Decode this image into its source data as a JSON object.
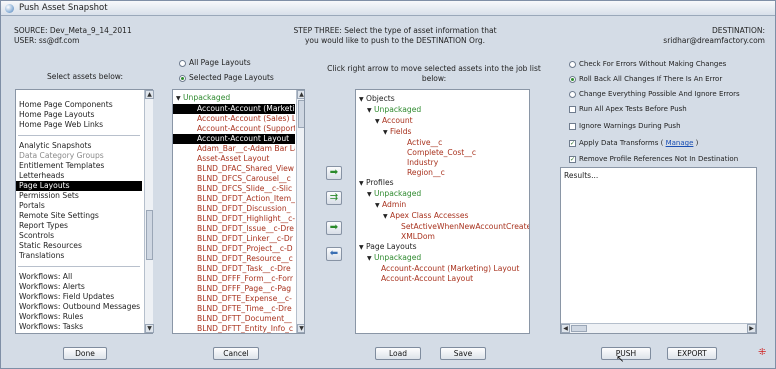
{
  "window": {
    "title": "Push Asset Snapshot"
  },
  "header": {
    "source": "SOURCE: Dev_Meta_9_14_2011",
    "user": "USER: ss@df.com",
    "step_line1": "STEP THREE: Select the type of asset information that",
    "step_line2": "you would like to push to the DESTINATION Org.",
    "dest_label": "DESTINATION:",
    "dest_user": "sridhar@dreamfactory.com"
  },
  "left": {
    "prompt": "Select assets below:",
    "groups": [
      [
        "Home Page Components",
        "Home Page Layouts",
        "Home Page Web Links"
      ],
      [
        "Analytic Snapshots",
        "Data Category Groups",
        "Entitlement Templates",
        "Letterheads",
        "Page Layouts",
        "Permission Sets",
        "Portals",
        "Remote Site Settings",
        "Report Types",
        "Scontrols",
        "Static Resources",
        "Translations"
      ],
      [
        "Workflows: All",
        "Workflows: Alerts",
        "Workflows: Field Updates",
        "Workflows: Outbound Messages",
        "Workflows: Rules",
        "Workflows: Tasks"
      ]
    ],
    "done": "Done"
  },
  "middle": {
    "radio_all": "All Page Layouts",
    "radio_selected": "Selected Page Layouts",
    "root": "Unpackaged",
    "items": [
      "Account-Account (Marketing",
      "Account-Account (Sales) La",
      "Account-Account (Support) L",
      "Account-Account Layout",
      "Adam_Bar__c-Adam Bar La",
      "Asset-Asset Layout",
      "BLND_DFAC_Shared_View",
      "BLND_DFCS_Carousel__c",
      "BLND_DFCS_Slide__c-Slic",
      "BLND_DFDT_Action_Item_",
      "BLND_DFDT_Discussion_",
      "BLND_DFDT_Highlight__c-",
      "BLND_DFDT_Issue__c-Dre",
      "BLND_DFDT_Linker__c-Dr",
      "BLND_DFDT_Project__c-D",
      "BLND_DFDT_Resource__c",
      "BLND_DFDT_Task__c-Dre",
      "BLND_DFFF_Form__c-Forr",
      "BLND_DFFF_Page__c-Pag",
      "BLND_DFTE_Expense__c-",
      "BLND_DFTE_Time__c-Dre",
      "BLND_DFTT_Document__",
      "BLND_DFTT_Entity_Info_c"
    ],
    "cancel": "Cancel"
  },
  "job": {
    "instruction_line1": "Click right arrow to move selected assets into the job list",
    "instruction_line2": "below:",
    "tree": {
      "objects": "Objects",
      "unpackaged": "Unpackaged",
      "account": "Account",
      "fields": "Fields",
      "field_items": [
        "Active__c",
        "Complete_Cost__c",
        "Industry",
        "Region__c"
      ],
      "profiles": "Profiles",
      "admin": "Admin",
      "apex": "Apex Class Accesses",
      "apex_items": [
        "SetActiveWhenNewAccountCreate",
        "XMLDom"
      ],
      "page_layouts": "Page Layouts",
      "layout_items": [
        "Account-Account (Marketing) Layout",
        "Account-Account Layout"
      ]
    },
    "load": "Load",
    "save": "Save"
  },
  "options": {
    "check_errors": "Check For Errors Without Making Changes",
    "rollback": "Roll Back All Changes If There Is An Error",
    "change_everything": "Change Everything Possible And Ignore Errors",
    "run_apex": "Run All Apex Tests Before Push",
    "ignore_warnings": "Ignore Warnings During Push",
    "apply_transforms": "Apply Data Transforms (",
    "manage": "Manage",
    "apply_transforms_end": ")",
    "remove_profile": "Remove Profile References Not In Destination",
    "results": "Results...",
    "push": "PUSH",
    "export": "EXPORT"
  }
}
